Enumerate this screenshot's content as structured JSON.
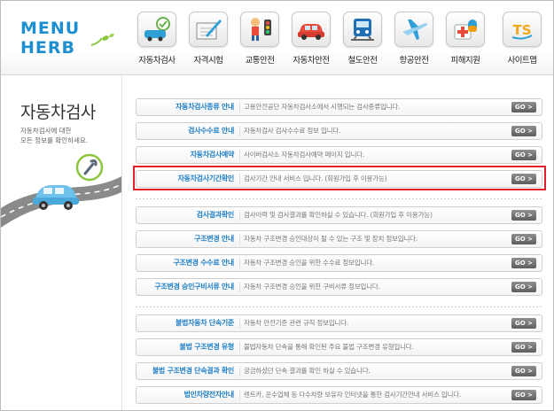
{
  "logo": {
    "line1": "MENU",
    "line2": "HERB"
  },
  "nav": [
    {
      "label": "자동차검사",
      "icon": "car-inspection-icon"
    },
    {
      "label": "자격시험",
      "icon": "notebook-pen-icon"
    },
    {
      "label": "교통안전",
      "icon": "traffic-light-icon"
    },
    {
      "label": "자동차안전",
      "icon": "car-icon"
    },
    {
      "label": "철도안전",
      "icon": "train-icon"
    },
    {
      "label": "항공안전",
      "icon": "airplane-icon"
    },
    {
      "label": "피해지원",
      "icon": "medical-box-icon"
    },
    {
      "label": "사이트맵",
      "icon": "ts-logo-icon"
    }
  ],
  "sidebar": {
    "title": "자동차검사",
    "desc_line1": "자동차검사에 대한",
    "desc_line2": "모든 정보를 확인하세요."
  },
  "go_label": "GO >",
  "rows": [
    {
      "name": "자동차검사종류 안내",
      "desc": "고용안전공단 자동차검사소에서 시행되는 검사종류입니다."
    },
    {
      "name": "검사수수료 안내",
      "desc": "자동차검사 검사수수료 정보 입니다."
    },
    {
      "name": "자동차검사예약",
      "desc": "사이버검사소 자동차검사예약 페이지 입니다."
    },
    {
      "name": "자동차검사기간확인",
      "desc": "검사기간 안내 서비스 입니다. (회원가입 후 이용가능)"
    },
    {
      "name": "검사결과확인",
      "desc": "검사이력 및 검사결과를 확인하실 수 있습니다. (회원가입 후 이용가능)"
    },
    {
      "name": "구조변경 안내",
      "desc": "자동차 구조변경 승인대상이 될 수 있는 구조 및 장치 정보입니다."
    },
    {
      "name": "구조변경 수수료 안내",
      "desc": "자동차 구조변경 승인을 위한 수수료 정보입니다."
    },
    {
      "name": "구조변경 승인구비서류 안내",
      "desc": "자동차 구조변경 승인을 위한 구비서류 정보입니다."
    },
    {
      "name": "불법자동차 단속기준",
      "desc": "자동차 안전기준 관련 규칙 정보입니다."
    },
    {
      "name": "불법 구조변경 유형",
      "desc": "불법자동차 단속을 통해 확인된 주요 불법 구조변경 유형입니다."
    },
    {
      "name": "불법 구조변경 단속결과 확인",
      "desc": "궁금하셨던 단속 결과를 확인 하실 수 있습니다."
    },
    {
      "name": "법인차량전자안내",
      "desc": "렌트카, 운수업체 등 다수차량 보유자 인터넷을 통한 검사기간안내 서비스 입니다."
    }
  ]
}
